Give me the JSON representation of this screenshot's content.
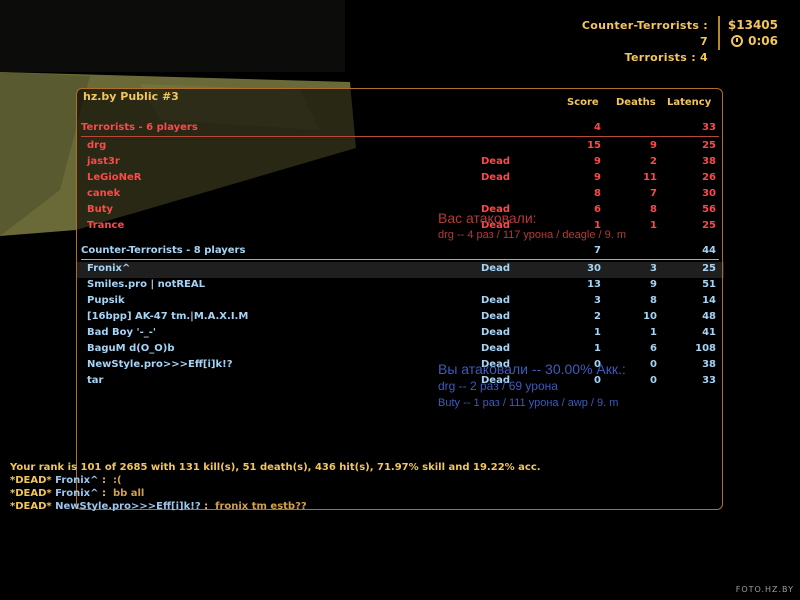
{
  "hud": {
    "ct_label": "Counter-Terrorists : 7",
    "t_label": "Terrorists : 4",
    "money": "$13405",
    "timer": "0:06"
  },
  "scoreboard": {
    "server_name": "hz.by Public #3",
    "columns": {
      "score": "Score",
      "deaths": "Deaths",
      "latency": "Latency"
    },
    "terrorists": {
      "header": "Terrorists   -   6 players",
      "score": "4",
      "deaths": "",
      "latency": "33",
      "players": [
        {
          "name": "drg",
          "status": "",
          "score": "15",
          "deaths": "9",
          "latency": "25"
        },
        {
          "name": "jast3r",
          "status": "Dead",
          "score": "9",
          "deaths": "2",
          "latency": "38"
        },
        {
          "name": "LeGioNeR",
          "status": "Dead",
          "score": "9",
          "deaths": "11",
          "latency": "26"
        },
        {
          "name": "canek",
          "status": "",
          "score": "8",
          "deaths": "7",
          "latency": "30"
        },
        {
          "name": "Buty",
          "status": "Dead",
          "score": "6",
          "deaths": "8",
          "latency": "56"
        },
        {
          "name": "Trance",
          "status": "Dead",
          "score": "1",
          "deaths": "1",
          "latency": "25"
        }
      ]
    },
    "counter_terrorists": {
      "header": "Counter-Terrorists   -   8 players",
      "score": "7",
      "deaths": "",
      "latency": "44",
      "players": [
        {
          "name": "Fronix^",
          "status": "Dead",
          "score": "30",
          "deaths": "3",
          "latency": "25"
        },
        {
          "name": "Smiles.pro | notREAL",
          "status": "",
          "score": "13",
          "deaths": "9",
          "latency": "51"
        },
        {
          "name": "Pupsik",
          "status": "Dead",
          "score": "3",
          "deaths": "8",
          "latency": "14"
        },
        {
          "name": "[16bpp] AK-47 tm.|M.A.X.I.M",
          "status": "Dead",
          "score": "2",
          "deaths": "10",
          "latency": "48"
        },
        {
          "name": "Bad Boy '-_-'",
          "status": "Dead",
          "score": "1",
          "deaths": "1",
          "latency": "41"
        },
        {
          "name": "BaguM d(O_O)b",
          "status": "Dead",
          "score": "1",
          "deaths": "6",
          "latency": "108"
        },
        {
          "name": "NewStyle.pro>>>Eff[i]k!?",
          "status": "Dead",
          "score": "0",
          "deaths": "0",
          "latency": "38"
        },
        {
          "name": "tar",
          "status": "Dead",
          "score": "0",
          "deaths": "0",
          "latency": "33"
        }
      ]
    }
  },
  "damage_received": {
    "title": "Вас атаковали:",
    "line": "drg -- 4 раз / 117 урона / deagle / 9. m"
  },
  "damage_dealt": {
    "title": "Вы атаковали -- 30.00% Акк.:",
    "line1": "drg -- 2 раз / 69 урона",
    "line2": "Buty -- 1 раз / 111 урона / awp / 9. m"
  },
  "chat": {
    "rank": "Your rank is 101 of 2685 with 131 kill(s), 51 death(s), 436 hit(s), 71.97% skill and 19.22% acc.",
    "lines": [
      {
        "prefix": "*DEAD*",
        "name": "Fronix^",
        "sep": " :  ",
        "msg": ":("
      },
      {
        "prefix": "*DEAD*",
        "name": "Fronix^",
        "sep": " :  ",
        "msg": "bb all"
      },
      {
        "prefix": "*DEAD*",
        "name": "NewStyle.pro>>>Eff[i]k!?",
        "sep": " :  ",
        "msg": "fronix tm estb??"
      }
    ]
  },
  "watermark": "FOTO.HZ.BY"
}
